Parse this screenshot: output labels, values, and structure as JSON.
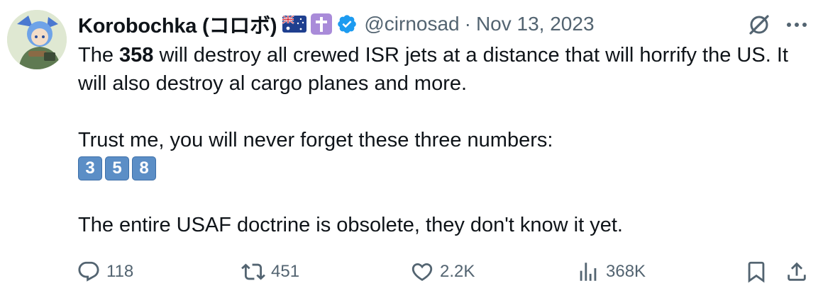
{
  "tweet": {
    "author": {
      "display_name": "Korobochka (コロボ)",
      "handle": "@cirnosad",
      "badges": [
        "australia-flag-icon",
        "latin-cross-icon",
        "verified-badge-icon"
      ]
    },
    "separator": "·",
    "timestamp": "Nov 13, 2023",
    "body": {
      "p1_before": "The ",
      "p1_bold": "358",
      "p1_after": " will destroy all crewed ISR jets at a distance that will horrify the US. It will also destroy al cargo planes and more.",
      "p2": "Trust me, you will never forget these three numbers:",
      "keycaps": [
        "3",
        "5",
        "8"
      ],
      "p3": "The entire USAF doctrine is obsolete, they don't know it yet."
    },
    "actions": {
      "replies": "118",
      "reposts": "451",
      "likes": "2.2K",
      "views": "368K"
    },
    "colors": {
      "text": "#0f1419",
      "secondary": "#536471",
      "verified": "#1d9bf0",
      "keycap": "#5b8ec6"
    }
  }
}
